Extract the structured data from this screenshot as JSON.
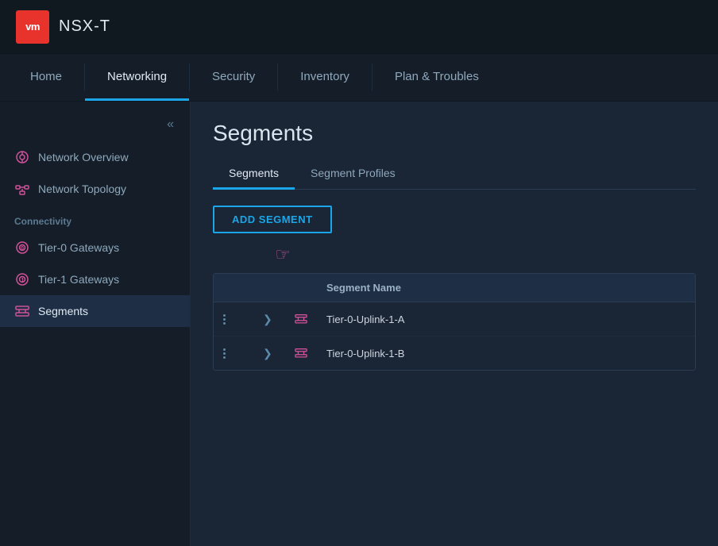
{
  "topbar": {
    "logo": "vm",
    "app_name": "NSX-T"
  },
  "nav": {
    "tabs": [
      {
        "id": "home",
        "label": "Home",
        "active": false
      },
      {
        "id": "networking",
        "label": "Networking",
        "active": true
      },
      {
        "id": "security",
        "label": "Security",
        "active": false
      },
      {
        "id": "inventory",
        "label": "Inventory",
        "active": false
      },
      {
        "id": "plan-troubles",
        "label": "Plan & Troubles",
        "active": false
      }
    ]
  },
  "sidebar": {
    "collapse_icon": "«",
    "items": [
      {
        "id": "network-overview",
        "label": "Network Overview",
        "icon": "overview"
      },
      {
        "id": "network-topology",
        "label": "Network Topology",
        "icon": "topology"
      }
    ],
    "sections": [
      {
        "label": "Connectivity",
        "items": [
          {
            "id": "tier0-gateways",
            "label": "Tier-0 Gateways",
            "icon": "tier0"
          },
          {
            "id": "tier1-gateways",
            "label": "Tier-1 Gateways",
            "icon": "tier1"
          },
          {
            "id": "segments",
            "label": "Segments",
            "icon": "segments",
            "active": true
          }
        ]
      }
    ]
  },
  "content": {
    "title": "Segments",
    "sub_tabs": [
      {
        "id": "segments",
        "label": "Segments",
        "active": true
      },
      {
        "id": "segment-profiles",
        "label": "Segment Profiles",
        "active": false
      }
    ],
    "add_button_label": "ADD SEGMENT",
    "table": {
      "columns": [
        "",
        "",
        "",
        "Segment Name"
      ],
      "rows": [
        {
          "dots": "⋮",
          "chevron": ">",
          "icon": "topology",
          "name": "Tier-0-Uplink-1-A"
        },
        {
          "dots": "⋮",
          "chevron": ">",
          "icon": "topology",
          "name": "Tier-0-Uplink-1-B"
        }
      ]
    }
  }
}
